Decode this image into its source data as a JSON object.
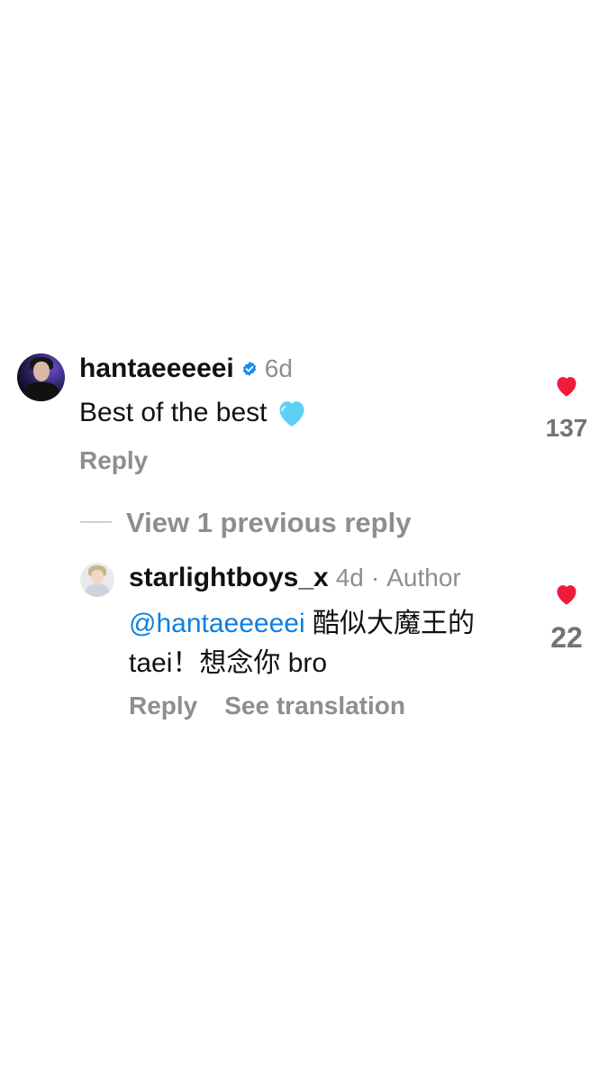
{
  "comments": [
    {
      "username": "hantaeeeeei",
      "verified": true,
      "time": "6d",
      "text": "Best of the best",
      "emoji": "light-blue-heart-icon",
      "likes": "137",
      "reply_label": "Reply"
    }
  ],
  "thread": {
    "view_previous_label": "View 1 previous reply"
  },
  "replies": [
    {
      "username": "starlightboys_x",
      "time": "4d",
      "separator": "·",
      "author_badge": "Author",
      "mention": "@hantaeeeeei",
      "text_line1_rest": "酷似大魔王的",
      "text_line2": "taei！想念你 bro",
      "likes": "22",
      "reply_label": "Reply",
      "translate_label": "See translation"
    }
  ],
  "colors": {
    "like_heart": "#ef1b3a",
    "mention": "#0f7fe0",
    "muted": "#8e8e8e",
    "verified": "#1c8df2",
    "emoji_heart": "#5fd0f5"
  }
}
